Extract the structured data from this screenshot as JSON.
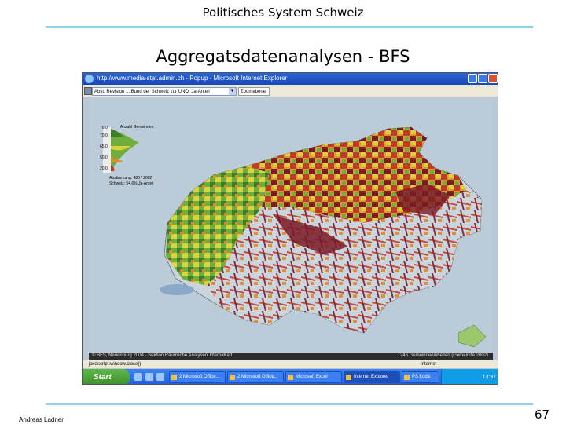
{
  "slide": {
    "header": "Politisches System Schweiz",
    "title": "Aggregatsdatenanalysen - BFS",
    "author": "Andreas Ladner",
    "page": "67"
  },
  "window": {
    "title": "http://www.media-stat.admin.ch - Popup - Microsoft Internet Explorer",
    "select_value": "Abst: Revision ... Bund der Schweiz zur UNO: Ja-Anteil",
    "zoom_label": "Zoomebene",
    "status_left": "© BFS, Neuenburg 2004 - Sektion Räumliche Analysen ThemaKart",
    "status_right": "1246 Gemeindeeinheiten (Gemeinde 2002)",
    "ie_status": "javascript:window.close()",
    "ie_zone": "Internet"
  },
  "legend": {
    "top_value": "76.0",
    "v2": "70.0",
    "v3": "65.0",
    "v4": "50.0",
    "v5": "20.0",
    "note1": "Abstimmung: 486 / 2002",
    "note2": "Schweiz: 54.6% Ja-Anteil",
    "header": "Anzahl Gemeinden"
  },
  "taskbar": {
    "start": "Start",
    "buttons": [
      "2 Microsoft Office...",
      "2 Microsoft Office...",
      "Microsoft Excel",
      "Internet Explorer",
      "PS Loda"
    ],
    "clock": "13:37"
  },
  "colors": {
    "accent_rule": "#8fd0ef",
    "map_dark_red": "#7a1a28",
    "map_red": "#c0392b",
    "map_orange": "#e08a2a",
    "map_yellow": "#d8d43a",
    "map_green": "#6fae3c",
    "map_dark_green": "#3e7d2a",
    "map_gray": "#c9d4dc"
  }
}
